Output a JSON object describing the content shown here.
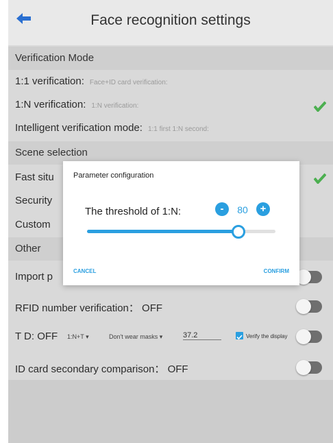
{
  "header": {
    "title": "Face recognition settings",
    "back_icon": "arrow-left-icon",
    "accent": "#2a6fd1"
  },
  "sections": {
    "verification_mode": "Verification Mode",
    "scene_selection": "Scene selection",
    "other": "Other"
  },
  "verification": {
    "one_to_one_label": "1:1 verification:",
    "one_to_one_sub": "Face+ID card verification:",
    "one_to_n_label": "1:N verification:",
    "one_to_n_sub": "1:N verification:",
    "intelligent_label": "Intelligent verification mode:",
    "intelligent_sub": "1:1 first 1:N second:"
  },
  "scene": {
    "fast": "Fast situ",
    "security": "Security",
    "custom": "Custom"
  },
  "other": {
    "import": "Import p",
    "rfid": "RFID number verification： OFF",
    "td_label": "T D: OFF",
    "td_mode": "1:N+T",
    "mask": "Don't wear masks",
    "temp": "37.2",
    "verify_display": "Verify the display",
    "id_card": "ID card secondary comparison： OFF"
  },
  "dialog": {
    "title": "Parameter configuration",
    "label": "The threshold of 1:N:",
    "value": "80",
    "minus": "-",
    "plus": "+",
    "slider_fraction": 0.8,
    "cancel": "CANCEL",
    "confirm": "CONFIRM"
  },
  "colors": {
    "accent": "#2a9fe0",
    "check": "#4caf50"
  }
}
